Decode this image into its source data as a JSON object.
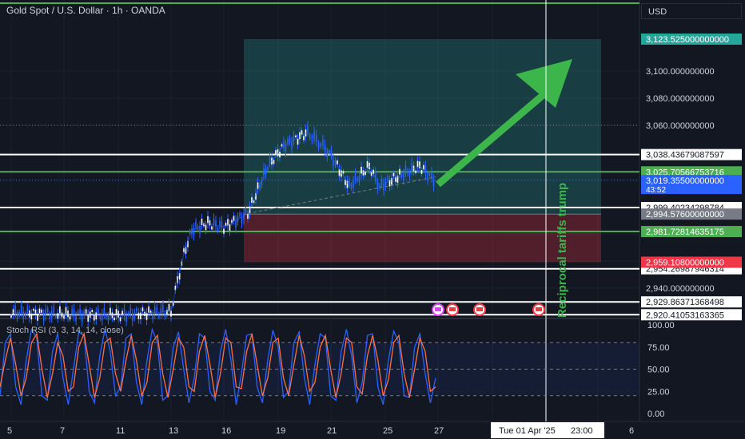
{
  "header": {
    "title": "Gold Spot / U.S. Dollar · 1h · OANDA",
    "currency": "USD"
  },
  "indicator": {
    "label": "Stoch RSI (3, 3, 14, 14, close)"
  },
  "annotation": {
    "text": "Reciprocal tariffs trump"
  },
  "crosshair": {
    "date_label": "Tue 01 Apr '25",
    "time_label": "23:00"
  },
  "colors": {
    "background": "#131722",
    "bull": "#2962ff",
    "green_line": "#4caf50",
    "white_line": "#ffffff",
    "profit_zone": "#26a69a",
    "loss_zone": "#f23645",
    "arrow": "#3cb54a",
    "stoch_k": "#2962ff",
    "stoch_d": "#ff7043"
  },
  "chart_data": {
    "type": "line",
    "symbol": "XAUUSD",
    "interval": "1h",
    "x_ticks": [
      "5",
      "7",
      "11",
      "13",
      "16",
      "19",
      "21",
      "25",
      "27",
      "6"
    ],
    "y_ticks": [
      "3,100.000000000",
      "3,080.000000000",
      "3,060.000000000",
      "3,040.000000000",
      "2,940.000000000"
    ],
    "ylim": [
      2920,
      3128
    ],
    "price_series": [
      {
        "day": "5",
        "price": 2922
      },
      {
        "day": "7",
        "price": 2921
      },
      {
        "day": "11",
        "price": 2920
      },
      {
        "day": "13",
        "price": 2923
      },
      {
        "day": "13.5",
        "price": 2945
      },
      {
        "day": "14",
        "price": 2965
      },
      {
        "day": "14.5",
        "price": 2983
      },
      {
        "day": "15",
        "price": 2988
      },
      {
        "day": "16",
        "price": 2985
      },
      {
        "day": "17",
        "price": 2995
      },
      {
        "day": "18",
        "price": 3030
      },
      {
        "day": "19",
        "price": 3045
      },
      {
        "day": "20",
        "price": 3055
      },
      {
        "day": "21",
        "price": 3040
      },
      {
        "day": "22",
        "price": 3015
      },
      {
        "day": "23",
        "price": 3030
      },
      {
        "day": "24",
        "price": 3015
      },
      {
        "day": "25",
        "price": 3020
      },
      {
        "day": "26",
        "price": 3030
      },
      {
        "day": "27",
        "price": 3019
      }
    ],
    "horizontal_levels": [
      {
        "label": "3,038.43679087597",
        "value": 3038.43679087597,
        "kind": "white"
      },
      {
        "label": "3,025.70566753716",
        "value": 3025.70566753716,
        "kind": "green"
      },
      {
        "label": "2,999.40234298784",
        "value": 2999.40234298784,
        "kind": "white"
      },
      {
        "label": "2,981.72814635175",
        "value": 2981.72814635175,
        "kind": "green"
      },
      {
        "label": "2,954.26987946314",
        "value": 2954.26987946314,
        "kind": "white"
      },
      {
        "label": "2,929.86371368498",
        "value": 2929.86371368498,
        "kind": "white"
      },
      {
        "label": "2,920.41053163365",
        "value": 2920.41053163365,
        "kind": "white"
      }
    ],
    "position": {
      "target": "3,123.525000000000",
      "target_value": 3123.525,
      "entry": "2,994.57600000000",
      "entry_value": 2994.576,
      "stop": "2,959.10800000000",
      "stop_value": 2959.108
    },
    "current_price": {
      "label": "3,019.35500000000",
      "value": 3019.355,
      "countdown": "43:52"
    },
    "stoch_rsi": {
      "y_ticks": [
        "100.00",
        "75.00",
        "50.00",
        "25.00",
        "0.00"
      ],
      "ylim": [
        0,
        100
      ],
      "k": [
        20,
        80,
        90,
        30,
        10,
        60,
        95,
        85,
        20,
        15,
        70,
        90,
        40,
        10,
        50,
        92,
        88,
        25,
        12,
        65,
        95,
        70,
        20,
        30,
        85,
        90,
        35,
        10,
        60,
        95,
        80,
        15,
        20,
        75,
        92,
        50,
        12,
        40,
        90,
        85,
        25,
        15,
        70,
        95,
        60,
        10,
        45,
        88,
        90,
        30,
        12,
        60,
        94,
        75,
        18,
        25,
        80,
        92,
        40,
        10,
        55,
        90,
        85,
        20,
        15,
        70,
        95,
        65,
        12,
        35,
        88,
        90,
        30,
        10,
        60,
        93,
        80,
        20,
        18,
        75,
        90,
        45,
        12,
        40
      ],
      "d": [
        30,
        60,
        85,
        55,
        20,
        40,
        80,
        90,
        50,
        18,
        45,
        80,
        65,
        25,
        30,
        75,
        90,
        55,
        18,
        40,
        80,
        85,
        45,
        25,
        60,
        88,
        60,
        20,
        35,
        80,
        88,
        45,
        18,
        50,
        85,
        75,
        30,
        25,
        70,
        88,
        55,
        18,
        45,
        85,
        80,
        30,
        28,
        70,
        90,
        55,
        20,
        40,
        80,
        85,
        40,
        20,
        55,
        88,
        65,
        25,
        35,
        75,
        88,
        50,
        18,
        45,
        85,
        80,
        30,
        22,
        65,
        88,
        60,
        20,
        38,
        80,
        88,
        45,
        18,
        50,
        85,
        70,
        25,
        30
      ]
    }
  }
}
